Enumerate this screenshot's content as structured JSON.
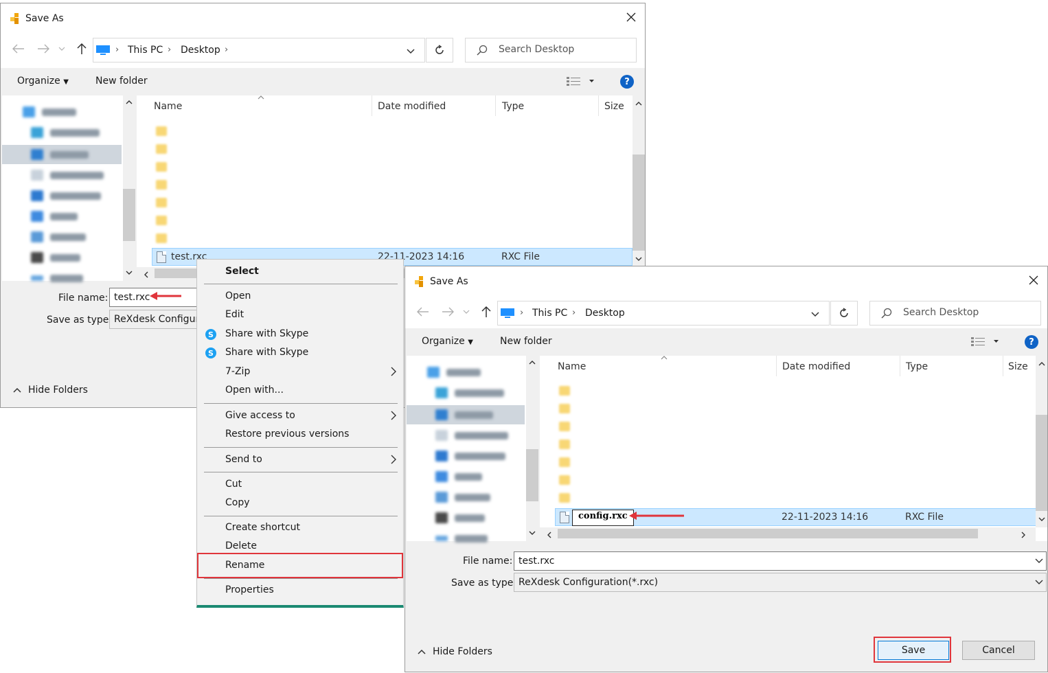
{
  "dialog1": {
    "title": "Save As",
    "breadcrumb": [
      "This PC",
      "Desktop"
    ],
    "search_placeholder": "Search Desktop",
    "toolbar": {
      "organize": "Organize",
      "new_folder": "New folder",
      "help": "?"
    },
    "columns": {
      "name": "Name",
      "date": "Date modified",
      "type": "Type",
      "size": "Size"
    },
    "selected_file": {
      "name": "test.rxc",
      "date": "22-11-2023 14:16",
      "type": "RXC File"
    },
    "file_name_label": "File name:",
    "file_name_value": "test.rxc",
    "save_as_type_label": "Save as type:",
    "save_as_type_value": "ReXdesk Configura",
    "hide_folders": "Hide Folders"
  },
  "context_menu": {
    "header": "Select",
    "items": {
      "open": "Open",
      "edit": "Edit",
      "share1": "Share with Skype",
      "share2": "Share with Skype",
      "zip": "7-Zip",
      "open_with": "Open with...",
      "give_access": "Give access to",
      "restore": "Restore previous versions",
      "send_to": "Send to",
      "cut": "Cut",
      "copy": "Copy",
      "create_shortcut": "Create shortcut",
      "delete": "Delete",
      "rename": "Rename",
      "properties": "Properties"
    }
  },
  "dialog2": {
    "title": "Save As",
    "breadcrumb": [
      "This PC",
      "Desktop"
    ],
    "search_placeholder": "Search Desktop",
    "toolbar": {
      "organize": "Organize",
      "new_folder": "New folder",
      "help": "?"
    },
    "columns": {
      "name": "Name",
      "date": "Date modified",
      "type": "Type",
      "size": "Size"
    },
    "selected_file": {
      "name": "config.rxc",
      "date": "22-11-2023 14:16",
      "type": "RXC File"
    },
    "file_name_label": "File name:",
    "file_name_value": "test.rxc",
    "save_as_type_label": "Save as type:",
    "save_as_type_value": "ReXdesk Configuration(*.rxc)",
    "hide_folders": "Hide Folders",
    "save_button": "Save",
    "cancel_button": "Cancel"
  },
  "colors": {
    "accent": "#0078d7",
    "highlight": "#e0353b",
    "selection": "#cce8ff",
    "folder": "#f8d775"
  }
}
